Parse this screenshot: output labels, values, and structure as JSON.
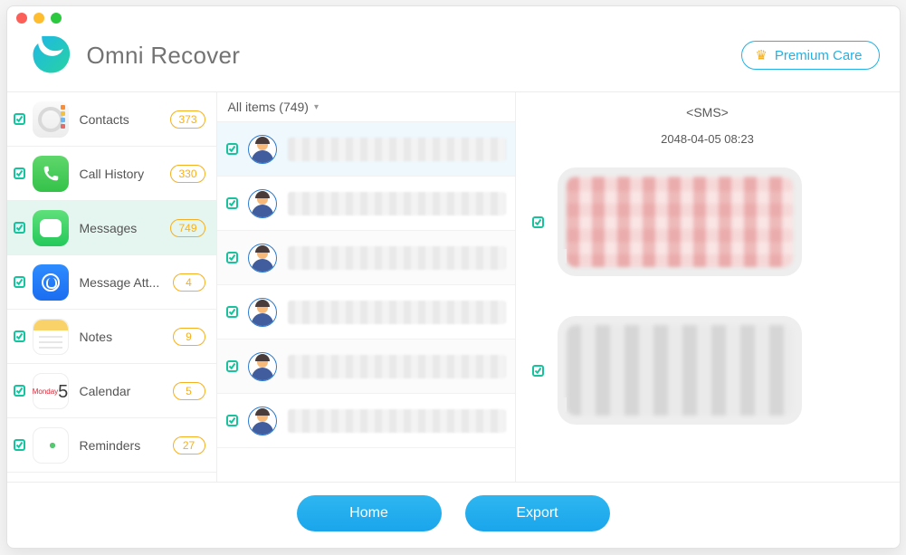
{
  "app": {
    "title": "Omni Recover"
  },
  "header": {
    "premium_label": "Premium Care"
  },
  "sidebar": {
    "items": [
      {
        "label": "Contacts",
        "count": "373",
        "icon": "contacts-icon"
      },
      {
        "label": "Call History",
        "count": "330",
        "icon": "call-history-icon"
      },
      {
        "label": "Messages",
        "count": "749",
        "icon": "messages-icon"
      },
      {
        "label": "Message Att...",
        "count": "4",
        "icon": "message-attachments-icon"
      },
      {
        "label": "Notes",
        "count": "9",
        "icon": "notes-icon"
      },
      {
        "label": "Calendar",
        "count": "5",
        "icon": "calendar-icon"
      },
      {
        "label": "Reminders",
        "count": "27",
        "icon": "reminders-icon"
      }
    ],
    "selected_index": 2,
    "calendar": {
      "dow": "Monday",
      "day": "5"
    }
  },
  "messages": {
    "filter_label": "All items (749)",
    "selected_index": 0,
    "threads": [
      {
        "checked": true
      },
      {
        "checked": true
      },
      {
        "checked": true
      },
      {
        "checked": true
      },
      {
        "checked": true
      },
      {
        "checked": true
      }
    ]
  },
  "conversation": {
    "type_label": "<SMS>",
    "timestamp": "2048-04-05 08:23",
    "bubbles": [
      {
        "style": "pink",
        "checked": true
      },
      {
        "style": "grey",
        "checked": true
      }
    ]
  },
  "footer": {
    "home_label": "Home",
    "export_label": "Export"
  }
}
